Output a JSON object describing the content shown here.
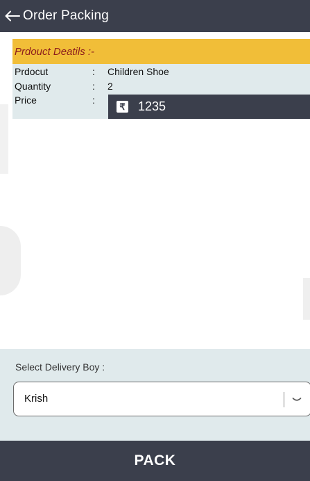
{
  "header": {
    "title": "Order Packing",
    "back_icon": "arrow-left-icon"
  },
  "product": {
    "heading": "Prdouct Deatils :-",
    "rows": [
      {
        "label": "Prdocut",
        "colon": ":",
        "value": "Children Shoe"
      },
      {
        "label": "Quantity",
        "colon": ":",
        "value": "2"
      },
      {
        "label": "Price",
        "colon": ":"
      }
    ],
    "price": {
      "currency_symbol": "₹",
      "value": "1235"
    }
  },
  "delivery": {
    "label": "Select Delivery Boy :",
    "selected": "Krish",
    "dropdown_icon": "chevron-down-icon"
  },
  "pack_button": {
    "label": "PACK"
  },
  "colors": {
    "dark": "#3b3f4c",
    "accent_yellow": "#f1be38",
    "heading_red": "#8c1c1c",
    "panel_bg": "#e0eaec"
  }
}
